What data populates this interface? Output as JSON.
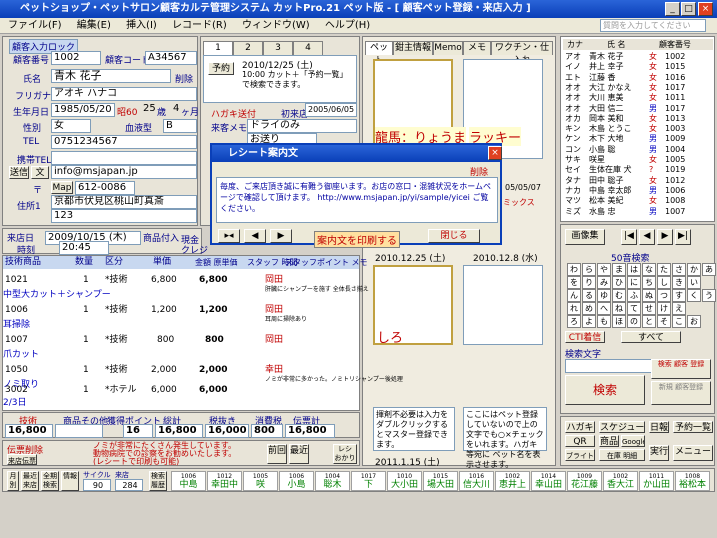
{
  "title": "ペットショップ・ペットサロン顧客カルテ管理システム カットPro.21 ペット版 - [ 顧客ペット登録・来店入力 ]",
  "menu": [
    "ファイル(F)",
    "編集(E)",
    "挿入(I)",
    "レコード(R)",
    "ウィンドウ(W)",
    "ヘルプ(H)"
  ],
  "search_placeholder": "質問を入力してください",
  "customer": {
    "input_section": "顧客入力ロック",
    "no_label": "顧客番号",
    "no": "1002",
    "code_label": "顧客コード",
    "code": "A34567",
    "name_label": "氏名",
    "name": "青木 花子",
    "delete_label": "削除",
    "kana_label": "フリガナ",
    "kana": "アオキ ハナコ",
    "birth_label": "生年月日",
    "birth": "1985/05/20",
    "era": "昭60",
    "age": "25",
    "age_unit": "歳",
    "months": "4",
    "months_unit": "ヶ月",
    "sex_label": "性別",
    "sex": "女",
    "blood_label": "血液型",
    "blood": "B",
    "tel_label": "TEL",
    "tel": "0751234567",
    "mobile_label": "携帯TEL",
    "mail_btn": "送信",
    "mail_btn2": "文",
    "email": "info@msjapan.jp",
    "zip_label": "〒",
    "map_btn": "Map",
    "zip": "612-0086",
    "addr_label": "住所1",
    "addr1": "京都市伏見区桃山町真斎",
    "addr2": "123"
  },
  "visit": {
    "date_label": "来店日",
    "date": "2009/10/15 (木)",
    "product_label": "商品付入",
    "time_label": "時刻",
    "time": "20:45",
    "cash": "現金",
    "credit": "クレジ"
  },
  "grid": {
    "headers": [
      "技術商品",
      "数量",
      "区分",
      "単価",
      "金額 原単価",
      "スタッフ 時間",
      "スタッフポイント メモ"
    ],
    "rows": [
      {
        "code": "1021",
        "name": "中型大カット＋シャンプー",
        "qty": "1",
        "cat": "*技術",
        "price": "6,800",
        "amount": "6,800",
        "staff": "岡田",
        "memo": "肝臓にシャンプーを施す 全体長さ揃え"
      },
      {
        "code": "1006",
        "name": "耳掃除",
        "qty": "1",
        "cat": "*技術",
        "price": "1,200",
        "amount": "1,200",
        "staff": "岡田",
        "memo": "耳周に掃除あり"
      },
      {
        "code": "1007",
        "name": "爪カット",
        "qty": "1",
        "cat": "*技術",
        "price": "800",
        "amount": "800",
        "staff": "岡田",
        "memo": ""
      },
      {
        "code": "1050",
        "name": "ノミ取り",
        "qty": "1",
        "cat": "*技術",
        "price": "2,000",
        "amount": "2,000",
        "staff": "幸田",
        "memo": "ノミが非常に多かった。ノミトリシャンプー後処理"
      },
      {
        "code": "3002",
        "name": "2/3日",
        "qty": "1",
        "cat": "*ホテル",
        "price": "6,000",
        "amount": "6,000",
        "staff": "",
        "memo": ""
      }
    ],
    "totals_labels": [
      "技術",
      "商品その他",
      "獲得ポイント",
      "総計",
      "税抜き",
      "消費税",
      "伝票計"
    ],
    "totals": [
      "16,800",
      "",
      "16",
      "16,800",
      "16,000",
      "800",
      "16,800"
    ],
    "note": "ノミが非常にたくさん発生しています。動物病院での診察をお勧めいたします。(レシートで印刷も可能)",
    "slip_delete": "伝票削除",
    "receipt_issue": "来店伝票",
    "receipt": "レシ おかり",
    "prev": "前回",
    "next": "最近"
  },
  "memo_panel": {
    "tabs": [
      "1",
      "2",
      "3",
      "4"
    ],
    "reserve": "予約",
    "date": "2010/12/25 (土)",
    "text": "10:00 カット＋「予約一覧」で検索できます。",
    "hagaki": "ハガキ送付",
    "first_visit_label": "初来店",
    "first_visit": "2005/06/05",
    "dm_label": "来客メモ",
    "dm": "ドライのみ",
    "okonomi": "お送り"
  },
  "pet_tabs": [
    "ペット",
    "鉗主情報",
    "Memo",
    "メモ",
    "ワクチン・仕入れ"
  ],
  "pets": [
    {
      "name": "龍馬：りょうま",
      "kind": "ラッキー",
      "date": "2011.1.15 (土)",
      "reserve": "予約"
    },
    {
      "name": "しろ",
      "date": "2010.12.25 (土)",
      "reserve": "予約"
    }
  ],
  "pet_date2": "2010.12.8 (水)",
  "pet_birth": "05/05/07",
  "pet_mix": "ミックス",
  "pet_memo": "揮剤不必要は入力をダブルクリックするとマスター登録できます。",
  "pet_memo2": "ここにはペット登録していないので上の文字でも○×チェックをいれます。ハガキ等宛に ペット名を表示させます。",
  "receipt_dialog": {
    "title": "レシート案内文",
    "delete": "削除",
    "text": "毎度、ご来店頂き誠に有難う御座います。お店の窓口・混雑状況をホームページで確認して頂けます。 http://www.msjapan.jp/yi/sample/yicei ご覧ください。",
    "print": "案内文を印刷する",
    "close": "閉じる"
  },
  "customer_list": {
    "headers": [
      "カナ",
      "氏 名",
      "顧客番号"
    ],
    "rows": [
      [
        "アオ",
        "青木 花子",
        "女",
        "1002"
      ],
      [
        "イノ",
        "井上 幸子",
        "女",
        "1015"
      ],
      [
        "エト",
        "江藤 香",
        "女",
        "1016"
      ],
      [
        "オオ",
        "大江 かなえ",
        "女",
        "1017"
      ],
      [
        "オオ",
        "大川 恵美",
        "女",
        "1011"
      ],
      [
        "オオ",
        "大田 信二",
        "男",
        "1017"
      ],
      [
        "オカ",
        "岡本 美和",
        "女",
        "1013"
      ],
      [
        "キン",
        "木島 とうこ",
        "女",
        "1003"
      ],
      [
        "ケン",
        "木下 大地",
        "男",
        "1009"
      ],
      [
        "コン",
        "小島 聡",
        "男",
        "1004"
      ],
      [
        "サキ",
        "咲星",
        "女",
        "1005"
      ],
      [
        "セイ",
        "生体在庫 犬",
        "?",
        "1019"
      ],
      [
        "タナ",
        "田中 聡子",
        "女",
        "1012"
      ],
      [
        "ナカ",
        "中島 幸太郎",
        "男",
        "1006"
      ],
      [
        "マツ",
        "松本 美紀",
        "女",
        "1008"
      ],
      [
        "ミズ",
        "水島 忠",
        "男",
        "1007"
      ]
    ]
  },
  "kana_search": {
    "btn_image": "画像集",
    "label": "50音検索",
    "rows": [
      "わらやまはなたさかあ",
      "をりみひにちしきい",
      "んるゆむふぬつすくう",
      "れめへねてせけえ",
      "ろよもほのとそこお"
    ],
    "cti": "CTI着信",
    "all": "すべて",
    "search_label": "検索文字",
    "search": "検索",
    "condition": "検索 顧客 登録",
    "new": "新規 顧客登録"
  },
  "bottom_right": [
    "ハガキ",
    "スケジュール",
    "日報",
    "予約一覧",
    "QR",
    "商品",
    "Google",
    "ブライト",
    "実行",
    "在庫 明細",
    "メニュー"
  ],
  "bottom_bar": {
    "labels": [
      "月別",
      "最近来店",
      "全期 検索",
      "情報",
      "サイクル",
      "来店",
      "検索 履歴"
    ],
    "cycle": "90",
    "visits": "284",
    "codes": [
      "1006",
      "1012",
      "1005",
      "1006",
      "1004",
      "1017",
      "1010",
      "1015",
      "1016",
      "1002",
      "1014",
      "1009",
      "1002",
      "1011",
      "1008"
    ],
    "names": [
      "中島",
      "幸田中",
      "咲",
      "小島",
      "聡木",
      "下",
      "大小田",
      "場大田",
      "信大川",
      "恵井上",
      "幸山田",
      "花江藤",
      "香大江",
      "か山田",
      "裕松本",
      "美青木",
      "大香木",
      "花"
    ]
  }
}
